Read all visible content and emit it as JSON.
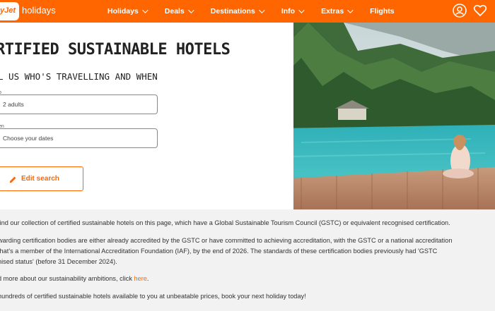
{
  "brand": {
    "logo_text": "yJet",
    "product": "holidays",
    "accent": "#ff6600"
  },
  "nav": {
    "items": [
      {
        "label": "Holidays",
        "has_dropdown": true
      },
      {
        "label": "Deals",
        "has_dropdown": true
      },
      {
        "label": "Destinations",
        "has_dropdown": true
      },
      {
        "label": "Info",
        "has_dropdown": true
      },
      {
        "label": "Extras",
        "has_dropdown": true
      },
      {
        "label": "Flights",
        "has_dropdown": false
      }
    ],
    "icons": [
      "user-icon",
      "heart-icon"
    ]
  },
  "hero": {
    "title": "RTIFIED SUSTAINABLE HOTELS",
    "subtitle": "L US WHO'S TRAVELLING AND WHEN",
    "who_label": "o",
    "who_value": "2 adults",
    "when_label": "en",
    "when_placeholder": "Choose your dates",
    "edit_button": "Edit search"
  },
  "content": {
    "p1": "find our collection of certified sustainable hotels on this page, which have a Global Sustainable Tourism Council (GSTC) or equivalent recognised certification.",
    "p2_line1": "warding certification bodies are either already accredited by the GSTC or have committed to achieving accreditation, with the GSTC or a national accreditation",
    "p2_line2": "that's a member of the International Accreditation Foundation (IAF), by the end of 2026. The standards of these certification bodies previously had 'GSTC",
    "p2_line3": "nised status' (before 31 December 2024).",
    "p3_prefix": "d more about our sustainability ambitions, click ",
    "p3_link": "here",
    "p3_suffix": ".",
    "p4": "hundreds of certified sustainable hotels available to you at unbeatable prices, book your next holiday today!"
  }
}
